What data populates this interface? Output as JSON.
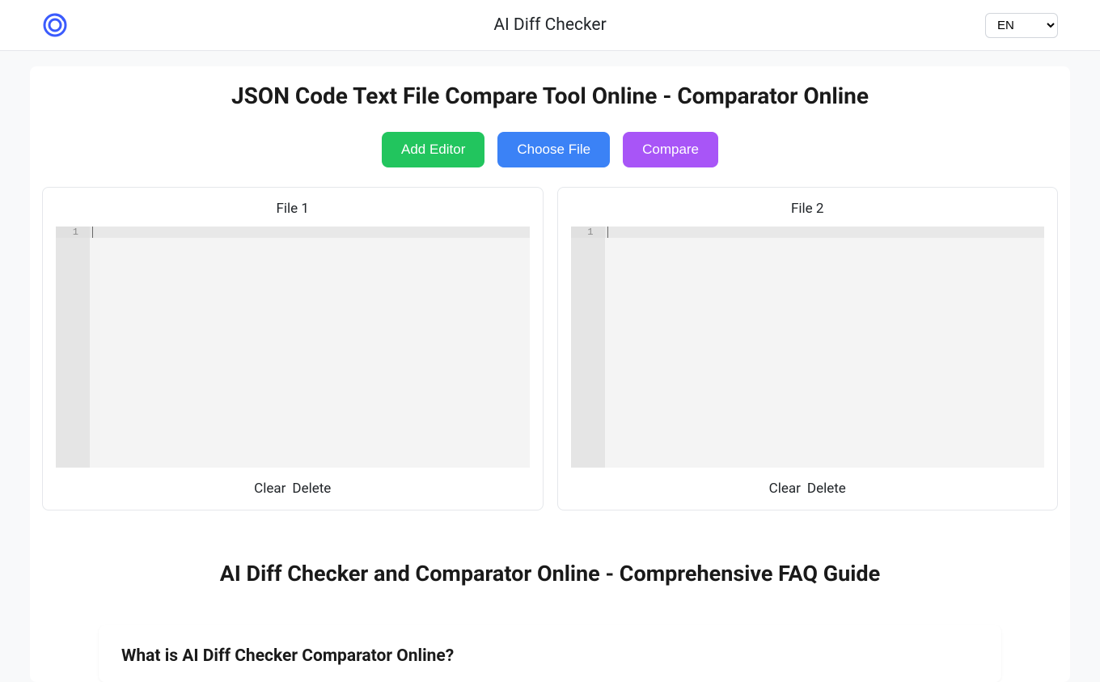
{
  "header": {
    "app_title": "AI Diff Checker",
    "lang_value": "EN"
  },
  "main": {
    "heading": "JSON Code Text File Compare Tool Online - Comparator Online",
    "buttons": {
      "add_editor": "Add Editor",
      "choose_file": "Choose File",
      "compare": "Compare"
    },
    "editors": [
      {
        "label": "File 1",
        "line_number": "1",
        "clear": "Clear",
        "delete": "Delete"
      },
      {
        "label": "File 2",
        "line_number": "1",
        "clear": "Clear",
        "delete": "Delete"
      }
    ]
  },
  "faq": {
    "title": "AI Diff Checker and Comparator Online - Comprehensive FAQ Guide",
    "question1": "What is AI Diff Checker Comparator Online?"
  }
}
